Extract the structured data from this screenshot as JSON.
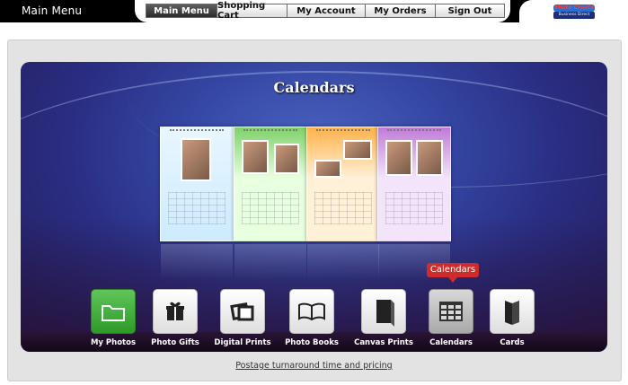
{
  "topbar": {
    "title": "Main Menu",
    "nav": [
      {
        "label": "Main Menu",
        "active": true
      },
      {
        "label": "Shopping Cart",
        "active": false
      },
      {
        "label": "My Account",
        "active": false
      },
      {
        "label": "My Orders",
        "active": false
      },
      {
        "label": "Sign Out",
        "active": false
      }
    ],
    "logo": {
      "line1": "Photo Create",
      "line2": "Business Direct"
    }
  },
  "stage": {
    "title": "Calendars"
  },
  "dock": {
    "tooltip": "Calendars",
    "items": [
      {
        "label": "My Photos",
        "icon": "folder-icon",
        "state": "normal-green"
      },
      {
        "label": "Photo Gifts",
        "icon": "gift-icon",
        "state": "normal"
      },
      {
        "label": "Digital Prints",
        "icon": "prints-icon",
        "state": "normal"
      },
      {
        "label": "Photo Books",
        "icon": "book-icon",
        "state": "normal"
      },
      {
        "label": "Canvas Prints",
        "icon": "canvas-icon",
        "state": "normal"
      },
      {
        "label": "Calendars",
        "icon": "calendar-icon",
        "state": "selected"
      },
      {
        "label": "Cards",
        "icon": "card-icon",
        "state": "normal"
      }
    ]
  },
  "footer": {
    "link": "Postage turnaround time and pricing"
  },
  "colors": {
    "accent_red": "#d02b2b",
    "stage_blue": "#3344a0",
    "topbar": "#000000"
  }
}
